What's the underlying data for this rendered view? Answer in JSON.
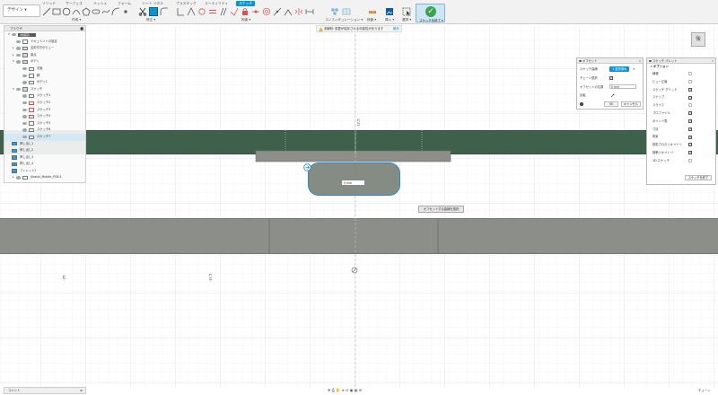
{
  "ribbon": {
    "workspace": "デザイン ▾",
    "tabs": [
      {
        "label": "ソリッド",
        "active": false
      },
      {
        "label": "サーフェス",
        "active": false
      },
      {
        "label": "メッシュ",
        "active": false
      },
      {
        "label": "フォーム",
        "active": false
      },
      {
        "label": "シート メタル",
        "active": false
      },
      {
        "label": "プラスチック",
        "active": false
      },
      {
        "label": "ユーティリティ",
        "active": false
      },
      {
        "label": "スケッチ",
        "active": true
      }
    ],
    "groups": {
      "create": "作成 ▾",
      "modify": "修正 ▾",
      "constraints": "拘束 ▾",
      "configure": "コンフィギュレーション ▾",
      "inspect": "検査 ▾",
      "insert": "挿入 ▾",
      "select": "選択 ▾"
    },
    "finish_sketch": "スケッチを終了 ▾"
  },
  "warning": {
    "label": "未解析:",
    "message": "変更が保存される可能性があります",
    "action": "解析"
  },
  "browser": {
    "title": "ブラウザ",
    "items": [
      {
        "label": "(未保存)",
        "indent": 0,
        "kind": "doc"
      },
      {
        "label": "ドキュメントの設定",
        "indent": 1,
        "kind": "gear"
      },
      {
        "label": "名前付きのビュー",
        "indent": 1,
        "kind": "folder"
      },
      {
        "label": "原点",
        "indent": 1,
        "kind": "folder"
      },
      {
        "label": "ボディ",
        "indent": 1,
        "kind": "folder"
      },
      {
        "label": "天板",
        "indent": 2,
        "kind": "body"
      },
      {
        "label": "脚",
        "indent": 2,
        "kind": "body"
      },
      {
        "label": "ボディ1",
        "indent": 2,
        "kind": "body"
      },
      {
        "label": "スケッチ",
        "indent": 1,
        "kind": "folder"
      },
      {
        "label": "スケッチ1",
        "indent": 2,
        "kind": "sketch"
      },
      {
        "label": "スケッチ2",
        "indent": 2,
        "kind": "sketch-err"
      },
      {
        "label": "スケッチ3",
        "indent": 2,
        "kind": "sketch-err"
      },
      {
        "label": "スケッチ4",
        "indent": 2,
        "kind": "sketch-err"
      },
      {
        "label": "スケッチ5",
        "indent": 2,
        "kind": "sketch"
      },
      {
        "label": "スケッチ6",
        "indent": 2,
        "kind": "sketch"
      },
      {
        "label": "スケッチ7",
        "indent": 2,
        "kind": "sketch",
        "selected": true
      },
      {
        "label": "押し出し1",
        "indent": 0,
        "kind": "feature"
      },
      {
        "label": "押し出し2",
        "indent": 0,
        "kind": "feature"
      },
      {
        "label": "押し出し3",
        "indent": 0,
        "kind": "feature"
      },
      {
        "label": "押し出し4",
        "indent": 0,
        "kind": "feature"
      },
      {
        "label": "フィレット1",
        "indent": 0,
        "kind": "feature"
      },
      {
        "label": "Akashi_Mobile_PCB:1",
        "indent": 1,
        "kind": "component"
      }
    ]
  },
  "offset_dialog": {
    "title": "オフセット",
    "rows": {
      "sketch_curve": "スケッチ曲線",
      "select_button": "1 選択済み",
      "chain_select": "チェーン選択",
      "offset_position": "オフセットの位置",
      "offset_value": "0 mm",
      "flip": "反転"
    },
    "ok": "OK",
    "cancel": "キャンセル"
  },
  "palette": {
    "title": "スケッチ パレット",
    "section": "オプション",
    "options": [
      {
        "label": "線種",
        "checked": false
      },
      {
        "label": "ビュー正面",
        "checked": false
      },
      {
        "label": "スケッチ グリッド",
        "checked": true
      },
      {
        "label": "スナップ",
        "checked": true
      },
      {
        "label": "スライス",
        "checked": false
      },
      {
        "label": "プロファイル",
        "checked": true
      },
      {
        "label": "ポイント表",
        "checked": true
      },
      {
        "label": "寸法",
        "checked": true
      },
      {
        "label": "拘束",
        "checked": true
      },
      {
        "label": "投影されたジオメトリ",
        "checked": true
      },
      {
        "label": "構築ジオメトリ",
        "checked": true
      },
      {
        "label": "3D スケッチ",
        "checked": false
      }
    ],
    "finish": "スケッチを終了"
  },
  "viewcube": {
    "label": "後"
  },
  "canvas": {
    "slot_input": "0 mm",
    "tooltip": "オフセットする曲線を選択",
    "dims": {
      "top": "12.5",
      "left1": "-25",
      "left2": "-12.5"
    }
  },
  "bottom": {
    "comments": "コメント",
    "timeline": "チューン"
  },
  "colors": {
    "accent": "#0696d7",
    "body_green": "#3f604a",
    "body_gray": "#8c8f89",
    "finish_green": "#3aa54a"
  }
}
